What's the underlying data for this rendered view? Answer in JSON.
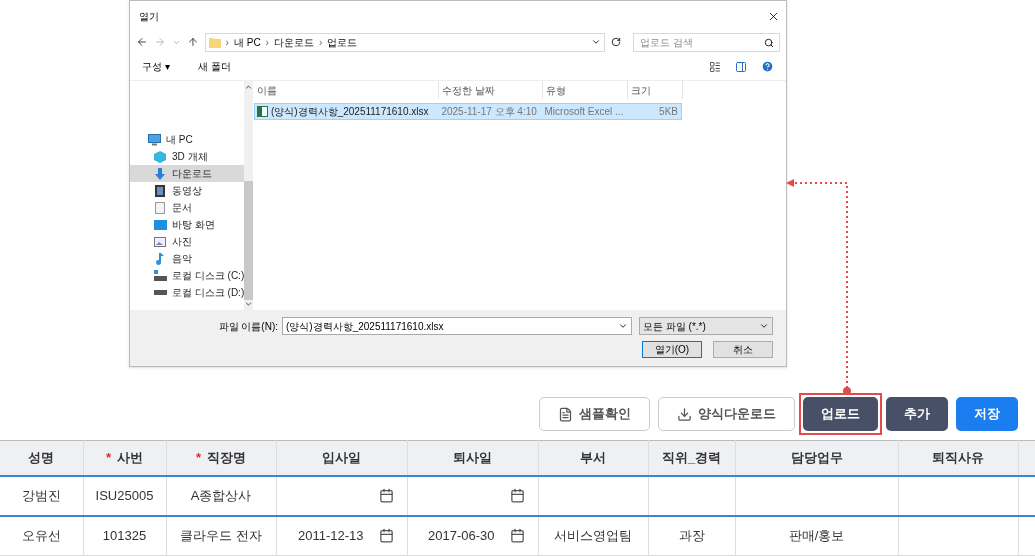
{
  "dialog": {
    "title": "열기",
    "breadcrumb": [
      "내 PC",
      "다운로드",
      "업로드"
    ],
    "separator": "›",
    "search": {
      "placeholder": "업로드 검색"
    },
    "toolbar": {
      "organize": "구성 ▾",
      "new_folder": "새 폴더"
    },
    "nav": [
      {
        "label": "내 PC",
        "kind": "pc",
        "selected": false,
        "children": [
          {
            "label": "3D 개체",
            "kind": "cube",
            "selected": false
          },
          {
            "label": "다운로드",
            "kind": "download",
            "selected": true
          },
          {
            "label": "동영상",
            "kind": "video",
            "selected": false
          },
          {
            "label": "문서",
            "kind": "doc",
            "selected": false
          },
          {
            "label": "바탕 화면",
            "kind": "desktop",
            "selected": false
          },
          {
            "label": "사진",
            "kind": "photo",
            "selected": false
          },
          {
            "label": "음악",
            "kind": "music",
            "selected": false
          },
          {
            "label": "로컬 디스크 (C:)",
            "kind": "disk",
            "selected": false
          },
          {
            "label": "로컬 디스크 (D:)",
            "kind": "drive",
            "selected": false
          }
        ]
      }
    ],
    "columns": [
      "이름",
      "수정한 날짜",
      "유형",
      "크기"
    ],
    "files": [
      {
        "name": "(양식)경력사항_202511171610.xlsx",
        "date": "2025-11-17 오후 4:10",
        "type": "Microsoft Excel ...",
        "size": "5KB",
        "selected": true
      }
    ],
    "filename_label": "파일 이름(N):",
    "filename": "(양식)경력사항_202511171610.xlsx",
    "filter": "모든 파일 (*.*)",
    "open": "열기(O)",
    "cancel": "취소"
  },
  "buttons": [
    {
      "label": "샘플확인",
      "kind": "file",
      "highlighted": false
    },
    {
      "label": "양식다운로드",
      "kind": "download",
      "highlighted": false
    },
    {
      "label": "업로드",
      "kind": "dark",
      "highlighted": true
    },
    {
      "label": "추가",
      "kind": "dark",
      "highlighted": false
    },
    {
      "label": "저장",
      "kind": "primary",
      "highlighted": false
    }
  ],
  "table": {
    "columns": [
      {
        "label": "성명"
      },
      {
        "label": "사번",
        "mark": "*"
      },
      {
        "label": "직장명",
        "mark": "*"
      },
      {
        "label": "입사일"
      },
      {
        "label": "퇴사일"
      },
      {
        "label": "부서"
      },
      {
        "label": "직위_경력"
      },
      {
        "label": "담당업무"
      },
      {
        "label": "퇴직사유"
      }
    ],
    "rows": [
      {
        "cells": [
          {
            "kind": "text",
            "text": "강범진"
          },
          {
            "kind": "text",
            "text": "ISU25005"
          },
          {
            "kind": "text",
            "text": "A종합상사"
          },
          {
            "kind": "date"
          },
          {
            "kind": "date"
          },
          {
            "kind": "text"
          },
          {
            "kind": "text"
          },
          {
            "kind": "text"
          },
          {
            "kind": "text"
          }
        ]
      },
      {
        "cells": [
          {
            "kind": "text",
            "text": "오유선"
          },
          {
            "kind": "text",
            "text": "101325"
          },
          {
            "kind": "text",
            "text": "클라우드 전자"
          },
          {
            "kind": "date",
            "text": "2011-12-13"
          },
          {
            "kind": "date",
            "text": "2017-06-30"
          },
          {
            "kind": "text",
            "text": "서비스영업팀"
          },
          {
            "kind": "text",
            "text": "과장"
          },
          {
            "kind": "text",
            "text": "판매/홍보"
          },
          {
            "kind": "text"
          }
        ]
      }
    ]
  }
}
